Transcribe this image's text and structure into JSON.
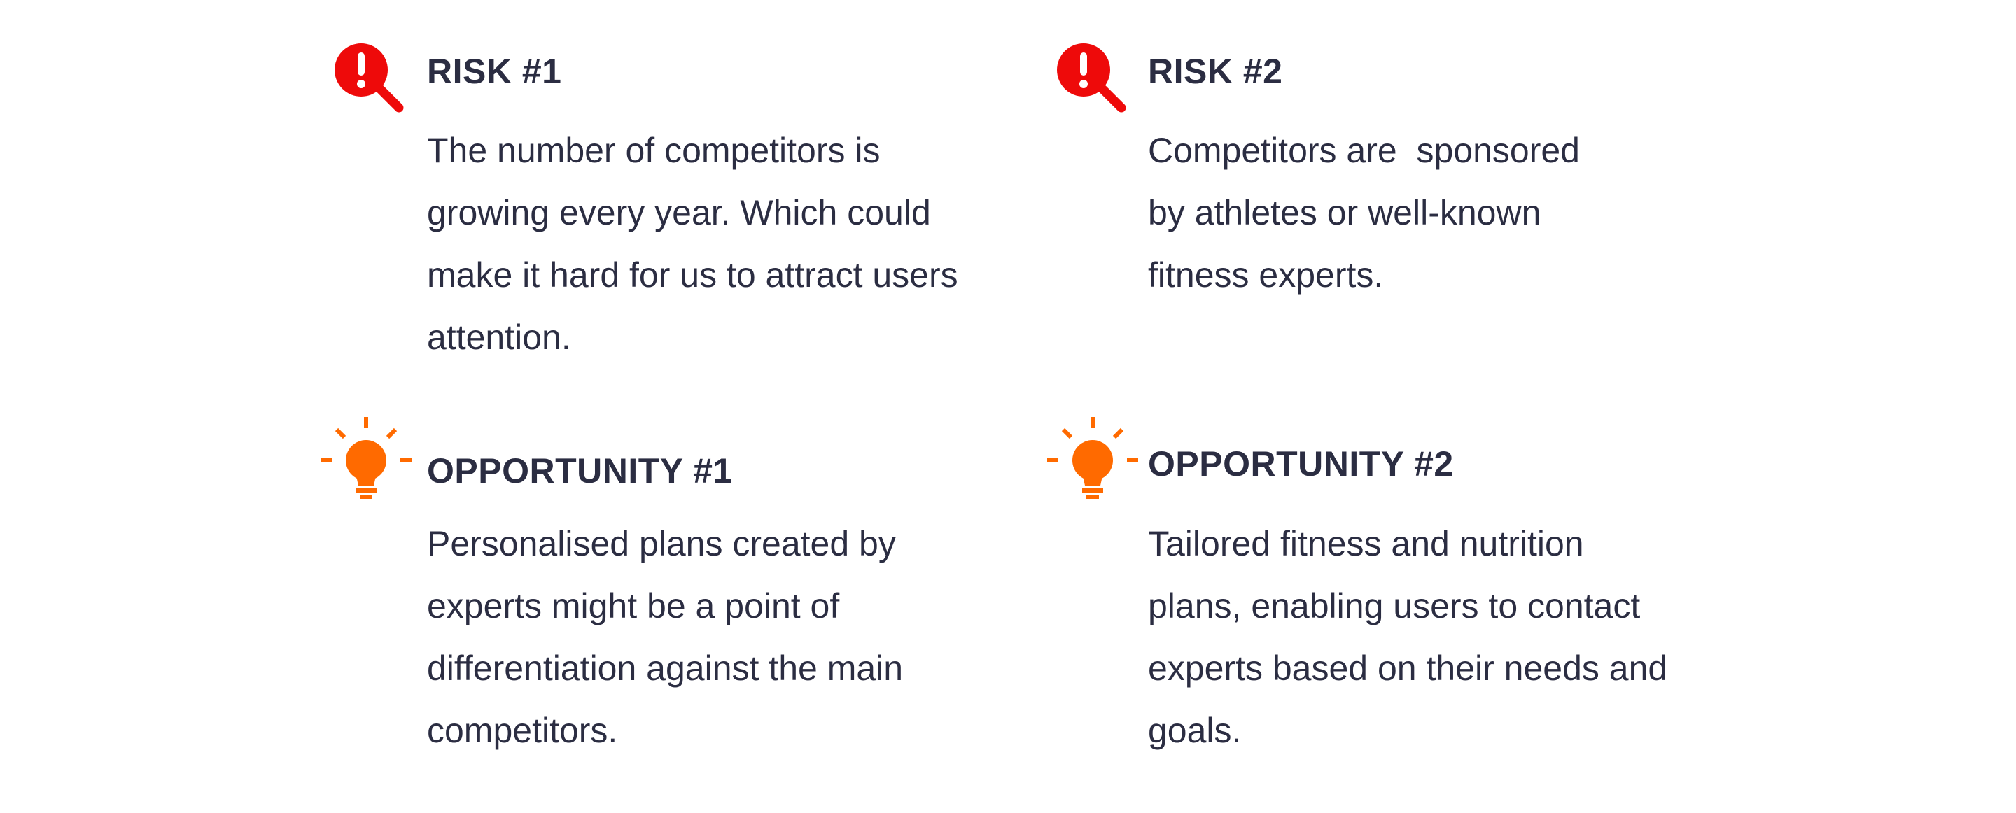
{
  "colors": {
    "text": "#2b2d42",
    "risk_icon": "#ee0a0a",
    "opportunity_icon": "#ff6a00"
  },
  "risks": [
    {
      "icon": "magnifier-alert-icon",
      "title": "RISK #1",
      "lines": [
        "The number of competitors is",
        "growing every year. Which could",
        "make it hard for us to attract users",
        "attention."
      ]
    },
    {
      "icon": "magnifier-alert-icon",
      "title": "RISK #2",
      "lines": [
        "Competitors are  sponsored",
        "by athletes or well-known",
        "fitness experts."
      ]
    }
  ],
  "opportunities": [
    {
      "icon": "lightbulb-icon",
      "title": "OPPORTUNITY #1",
      "lines": [
        "Personalised plans created by",
        "experts might be a point of",
        "differentiation against the main",
        "competitors."
      ]
    },
    {
      "icon": "lightbulb-icon",
      "title": "OPPORTUNITY #2",
      "lines": [
        "Tailored fitness and nutrition",
        "plans, enabling users to contact",
        "experts based on their needs and",
        "goals."
      ]
    }
  ]
}
